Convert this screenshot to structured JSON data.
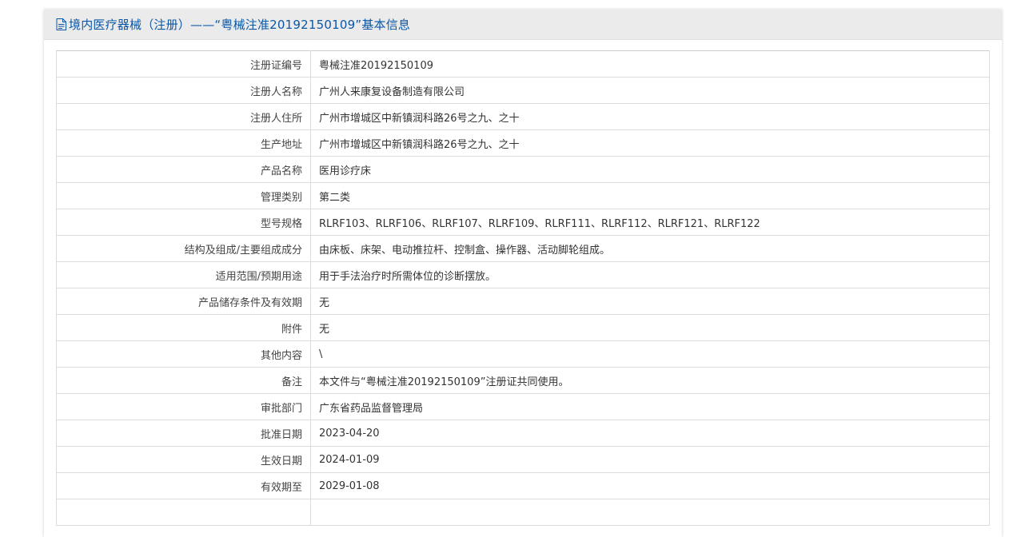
{
  "header": {
    "icon": "document-icon",
    "title": "境内医疗器械（注册）——“粤械注准20192150109”基本信息"
  },
  "colors": {
    "title": "#0b57a6",
    "header_bg": "#ebebeb",
    "border": "#dcdcdc"
  },
  "rows": [
    {
      "label": "注册证编号",
      "value": "粤械注准20192150109"
    },
    {
      "label": "注册人名称",
      "value": "广州人来康复设备制造有限公司"
    },
    {
      "label": "注册人住所",
      "value": "广州市增城区中新镇润科路26号之九、之十"
    },
    {
      "label": "生产地址",
      "value": "广州市增城区中新镇润科路26号之九、之十"
    },
    {
      "label": "产品名称",
      "value": "医用诊疗床"
    },
    {
      "label": "管理类别",
      "value": "第二类"
    },
    {
      "label": "型号规格",
      "value": "RLRF103、RLRF106、RLRF107、RLRF109、RLRF111、RLRF112、RLRF121、RLRF122"
    },
    {
      "label": "结构及组成/主要组成成分",
      "value": "由床板、床架、电动推拉杆、控制盒、操作器、活动脚轮组成。"
    },
    {
      "label": "适用范围/预期用途",
      "value": "用于手法治疗时所需体位的诊断摆放。"
    },
    {
      "label": "产品储存条件及有效期",
      "value": "无"
    },
    {
      "label": "附件",
      "value": "无"
    },
    {
      "label": "其他内容",
      "value": "\\"
    },
    {
      "label": "备注",
      "value": "本文件与“粤械注准20192150109”注册证共同使用。"
    },
    {
      "label": "审批部门",
      "value": "广东省药品监督管理局"
    },
    {
      "label": "批准日期",
      "value": "2023-04-20"
    },
    {
      "label": "生效日期",
      "value": "2024-01-09"
    },
    {
      "label": "有效期至",
      "value": "2029-01-08"
    },
    {
      "label": "",
      "value": ""
    }
  ]
}
